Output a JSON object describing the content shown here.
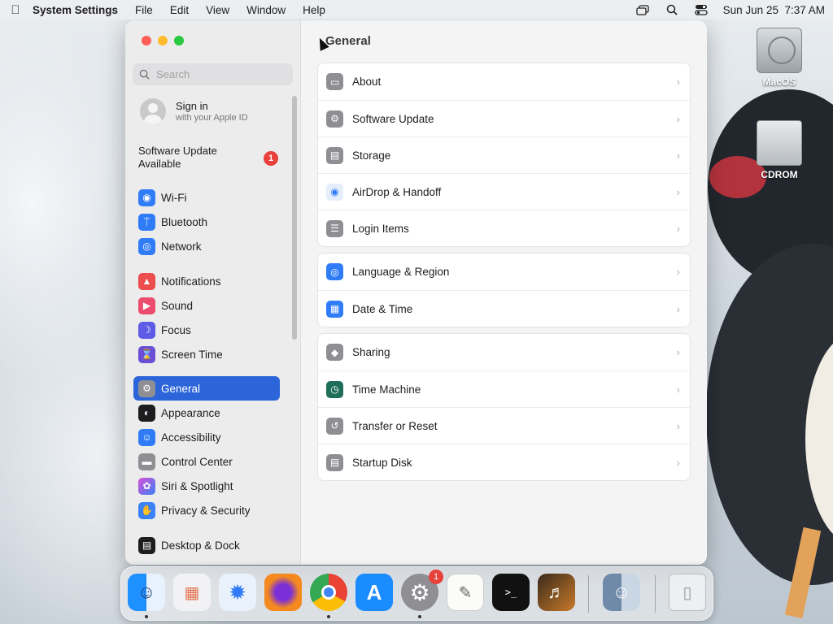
{
  "menubar": {
    "apple_icon": "apple-logo-icon",
    "app_name": "System Settings",
    "menus": [
      "File",
      "Edit",
      "View",
      "Window",
      "Help"
    ],
    "datetime": "Sun Jun 25  7:37 AM"
  },
  "sidebar": {
    "search_placeholder": "Search",
    "signin_title": "Sign in",
    "signin_subtitle": "with your Apple ID",
    "update_notice": "Software Update Available",
    "update_badge": "1",
    "items": [
      {
        "label": "Wi-Fi",
        "color": "#2f7cf6"
      },
      {
        "label": "Bluetooth",
        "color": "#2f7cf6"
      },
      {
        "label": "Network",
        "color": "#2f7cf6"
      },
      {
        "label": "Notifications",
        "color": "#ec4d4d"
      },
      {
        "label": "Sound",
        "color": "#ec4d6e"
      },
      {
        "label": "Focus",
        "color": "#5e5ce6"
      },
      {
        "label": "Screen Time",
        "color": "#6a4fd6"
      },
      {
        "label": "General",
        "color": "#8e8e93"
      },
      {
        "label": "Appearance",
        "color": "#1d1d1f"
      },
      {
        "label": "Accessibility",
        "color": "#2f7cf6"
      },
      {
        "label": "Control Center",
        "color": "#8e8e93"
      },
      {
        "label": "Siri & Spotlight",
        "color": "#7b4fd6"
      },
      {
        "label": "Privacy & Security",
        "color": "#3b82f6"
      },
      {
        "label": "Desktop & Dock",
        "color": "#1d1d1f"
      }
    ],
    "selected": "General"
  },
  "content": {
    "title": "General",
    "groups": [
      [
        {
          "label": "About",
          "icon": "laptop-icon"
        },
        {
          "label": "Software Update",
          "icon": "gear-icon"
        },
        {
          "label": "Storage",
          "icon": "drive-icon"
        },
        {
          "label": "AirDrop & Handoff",
          "icon": "airdrop-icon"
        },
        {
          "label": "Login Items",
          "icon": "list-icon"
        }
      ],
      [
        {
          "label": "Language & Region",
          "icon": "globe-icon"
        },
        {
          "label": "Date & Time",
          "icon": "calendar-icon"
        }
      ],
      [
        {
          "label": "Sharing",
          "icon": "sharing-icon"
        },
        {
          "label": "Time Machine",
          "icon": "time-machine-icon"
        },
        {
          "label": "Transfer or Reset",
          "icon": "reset-icon"
        },
        {
          "label": "Startup Disk",
          "icon": "disk-icon"
        }
      ]
    ]
  },
  "desktop": {
    "icons": [
      "MacOS",
      "CDROM"
    ]
  },
  "dock": {
    "apps": [
      "Finder",
      "Launchpad",
      "Safari",
      "Firefox",
      "Chrome",
      "App Store",
      "System Settings",
      "TextEdit",
      "Terminal",
      "Instruments",
      "Finder Window",
      "Trash"
    ],
    "settings_badge": "1"
  }
}
